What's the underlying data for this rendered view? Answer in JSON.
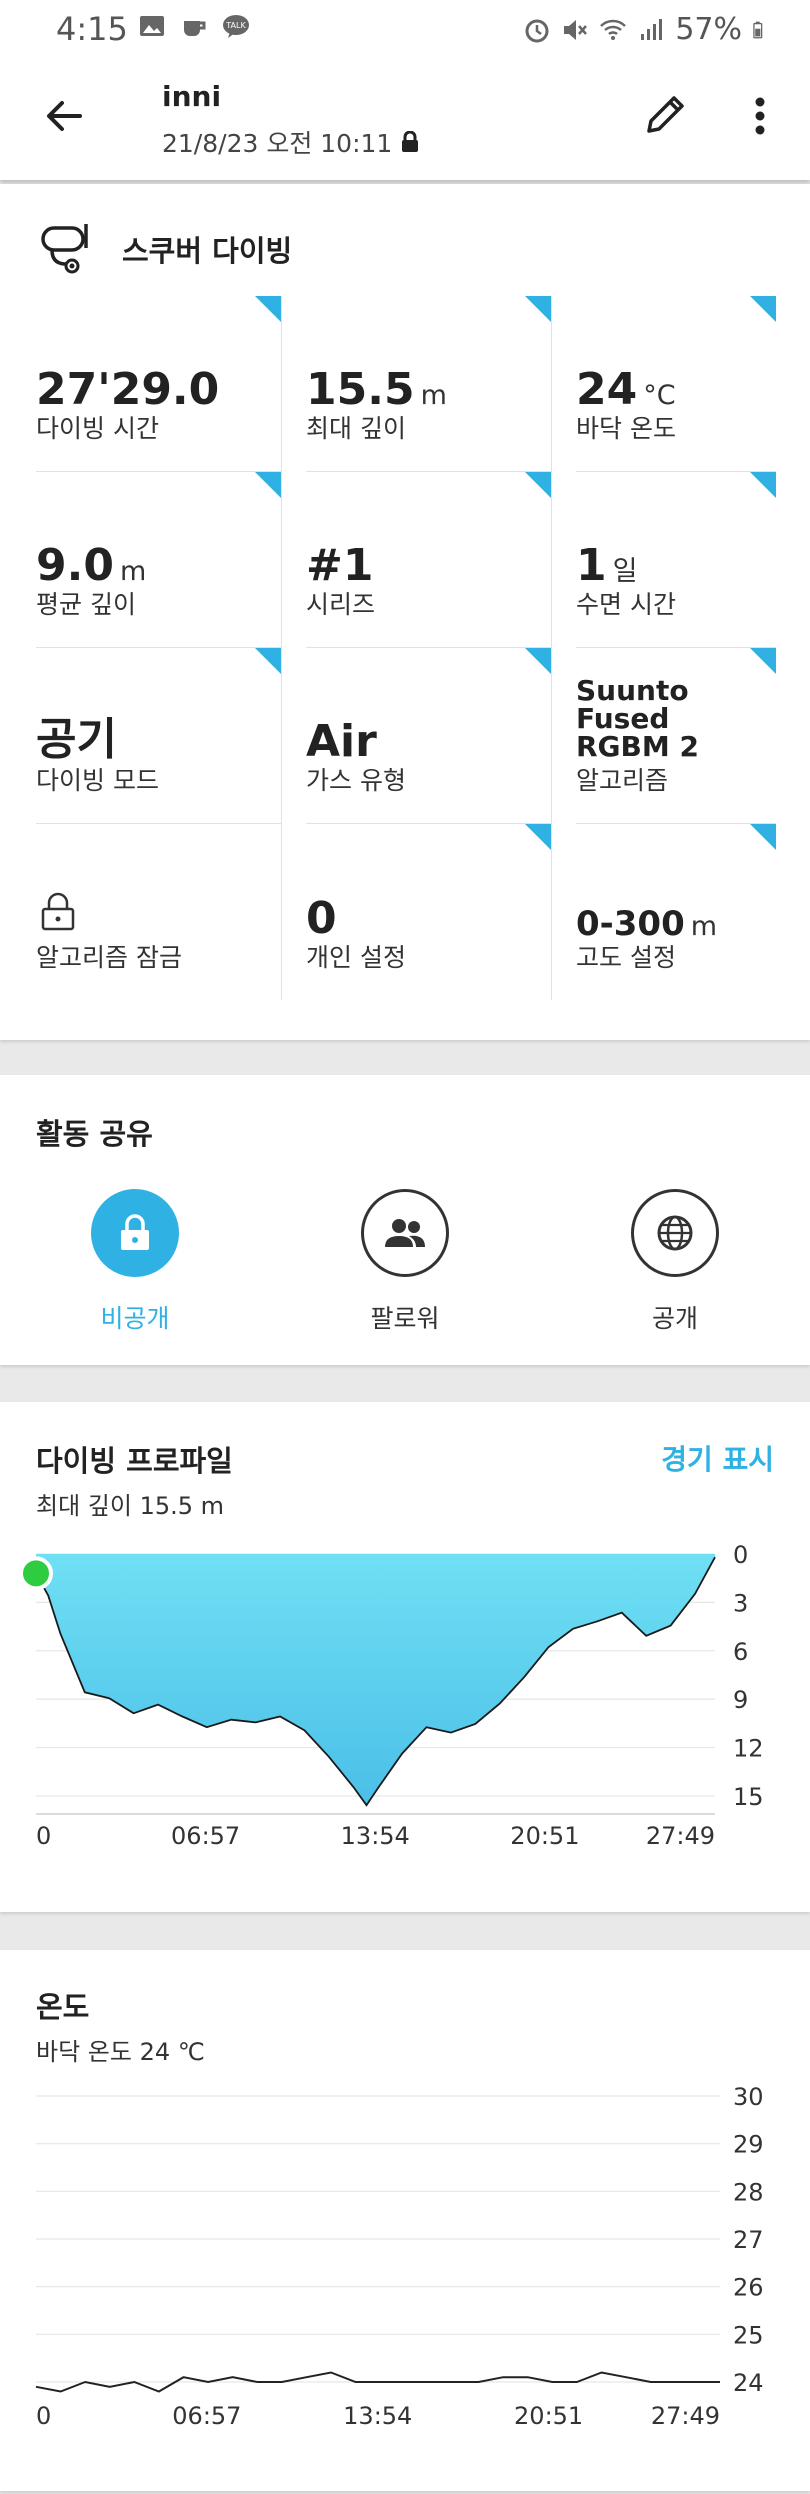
{
  "status_bar": {
    "time": "4:15",
    "battery": "57%"
  },
  "header": {
    "title": "inni",
    "datetime": "21/8/23 오전 10:11"
  },
  "sport": {
    "label": "스쿠버 다이빙",
    "icon": "scuba-mask-icon"
  },
  "stats": [
    {
      "value": "27'29.0",
      "unit": "",
      "label": "다이빙 시간"
    },
    {
      "value": "15.5",
      "unit": "m",
      "label": "최대 깊이"
    },
    {
      "value": "24",
      "unit": "°C",
      "label": "바닥 온도"
    },
    {
      "value": "9.0",
      "unit": "m",
      "label": "평균 깊이"
    },
    {
      "value": "#1",
      "unit": "",
      "label": "시리즈"
    },
    {
      "value": "1",
      "unit": "일",
      "label": "수면 시간"
    },
    {
      "value": "공기",
      "unit": "",
      "label": "다이빙 모드"
    },
    {
      "value": "Air",
      "unit": "",
      "label": "가스 유형"
    },
    {
      "value": "Suunto Fused RGBM 2",
      "unit": "",
      "label": "알고리즘"
    },
    {
      "value": "",
      "unit": "",
      "label": "알고리즘 잠금",
      "icon": "lock-icon"
    },
    {
      "value": "0",
      "unit": "",
      "label": "개인 설정"
    },
    {
      "value": "0-300",
      "unit": "m",
      "label": "고도 설정"
    }
  ],
  "share": {
    "title": "활동 공유",
    "options": [
      {
        "label": "비공개",
        "icon": "lock-icon",
        "selected": true
      },
      {
        "label": "팔로워",
        "icon": "followers-icon",
        "selected": false
      },
      {
        "label": "공개",
        "icon": "globe-icon",
        "selected": false
      }
    ]
  },
  "profile": {
    "title": "다이빙 프로파일",
    "subtitle": "최대 깊이 15.5 m",
    "link": "경기 표시"
  },
  "temperature": {
    "title": "온도",
    "subtitle": "바닥 온도 24 ℃"
  },
  "colors": {
    "accent": "#2fb1e3",
    "depth_fill_top": "#6fe0f4",
    "depth_fill_bottom": "#4bbfe8",
    "marker": "#2ecc40"
  },
  "chart_data": [
    {
      "type": "area",
      "xlabel": "",
      "ylabel": "",
      "x_ticks": [
        "0",
        "06:57",
        "13:54",
        "20:51",
        "27:49"
      ],
      "y_ticks": [
        "0",
        "3",
        "6",
        "9",
        "12",
        "15"
      ],
      "ylim": [
        0,
        15.5
      ],
      "y_inverted": true,
      "series": [
        {
          "x": [
            0,
            0.5,
            1.0,
            2.0,
            3.0,
            4.0,
            5.0,
            6.0,
            7.0,
            8.0,
            9.0,
            10.0,
            11.0,
            12.0,
            13.0,
            13.54,
            14.0,
            15.0,
            16.0,
            17.0,
            18.0,
            19.0,
            20.0,
            21.0,
            22.0,
            23.0,
            24.0,
            25.0,
            26.0,
            27.0,
            27.82
          ],
          "y": [
            1.2,
            2.5,
            5.0,
            8.5,
            9.0,
            9.8,
            9.4,
            10.0,
            10.8,
            10.2,
            10.5,
            10.0,
            11.0,
            12.5,
            14.5,
            15.5,
            14.6,
            12.3,
            10.8,
            11.0,
            10.6,
            9.2,
            7.7,
            5.7,
            4.7,
            4.1,
            3.7,
            5.0,
            4.5,
            2.4,
            0.2
          ]
        }
      ]
    },
    {
      "type": "line",
      "xlabel": "",
      "ylabel": "",
      "x_ticks": [
        "0",
        "06:57",
        "13:54",
        "20:51",
        "27:49"
      ],
      "y_ticks": [
        "30",
        "29",
        "28",
        "27",
        "26",
        "25",
        "24"
      ],
      "ylim": [
        24,
        30
      ],
      "series": [
        {
          "x": [
            0,
            1,
            2,
            3,
            4,
            5,
            6,
            7,
            8,
            9,
            10,
            11,
            12,
            13,
            14,
            15,
            16,
            17,
            18,
            19,
            20,
            21,
            22,
            23,
            24,
            25,
            26,
            27,
            27.82
          ],
          "y": [
            23.9,
            23.8,
            24.0,
            23.9,
            24.0,
            23.8,
            24.1,
            24.0,
            24.1,
            24.0,
            24.0,
            24.1,
            24.2,
            24.0,
            24.0,
            24.0,
            24.0,
            24.0,
            24.0,
            24.1,
            24.1,
            24.0,
            24.0,
            24.2,
            24.1,
            24.0,
            24.0,
            24.0,
            24.0
          ]
        }
      ]
    }
  ]
}
